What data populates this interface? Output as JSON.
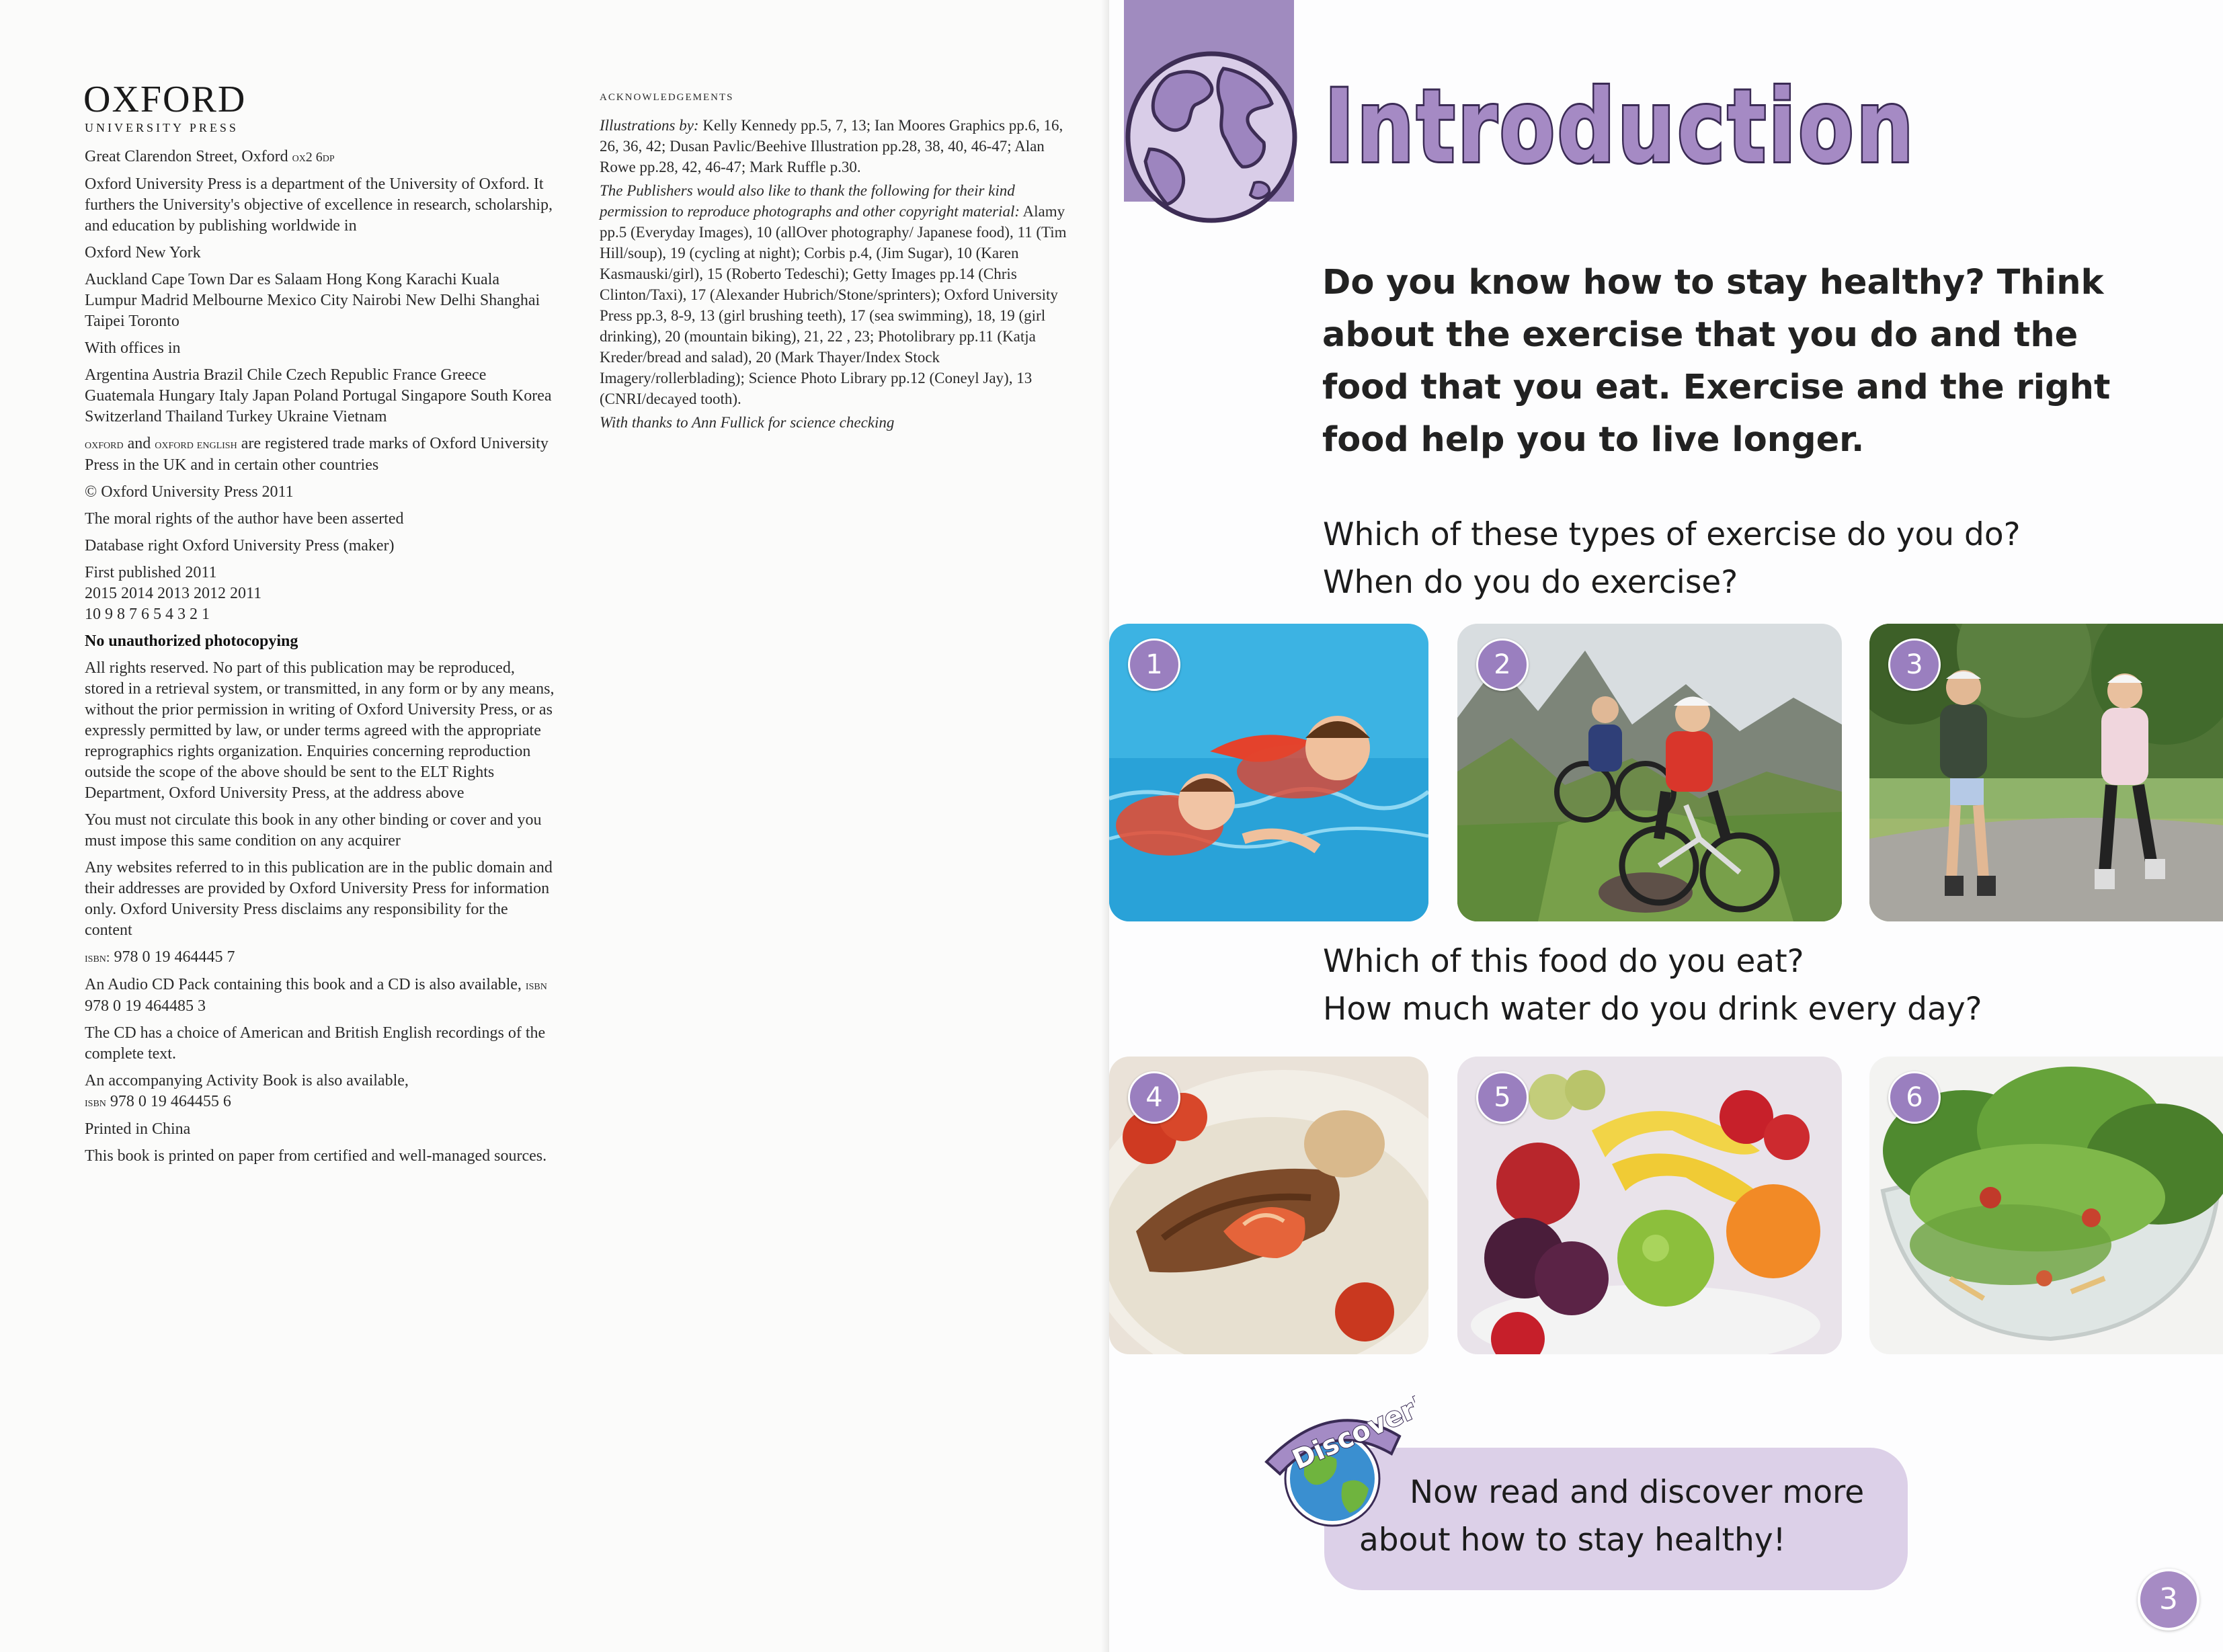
{
  "left_page": {
    "logo": {
      "name": "OXFORD",
      "sub": "UNIVERSITY PRESS"
    },
    "imprint": {
      "address_prefix": "Great Clarendon Street, Oxford",
      "postcode": "ox2 6dp",
      "mission": "Oxford University Press is a department of the University of Oxford. It furthers the University's objective of excellence in research, scholarship, and education by publishing worldwide in",
      "cities_main": "Oxford  New York",
      "cities_list": "Auckland  Cape Town  Dar es Salaam  Hong Kong  Karachi Kuala Lumpur  Madrid  Melbourne  Mexico City  Nairobi New Delhi  Shanghai  Taipei  Toronto",
      "offices_label": "With offices in",
      "countries": "Argentina  Austria  Brazil  Chile  Czech Republic  France Greece  Guatemala  Hungary  Italy  Japan  Poland  Portugal Singapore  South Korea  Switzerland  Thailand  Turkey Ukraine  Vietnam",
      "tm_mark1": "oxford",
      "tm_and": " and ",
      "tm_mark2": "oxford english",
      "tm_rest": " are registered trade marks of Oxford University Press in the UK and in certain other countries",
      "copyright": "© Oxford University Press 2011",
      "moral_rights": "The moral rights of the author have been asserted",
      "database": "Database right Oxford University Press (maker)",
      "first_published": "First published 2011",
      "years": "2015  2014  2013  2012  2011",
      "impression": "10  9  8  7  6  5  4  3  2  1",
      "no_photocopy": "No unauthorized photocopying",
      "rights": "All rights reserved. No part of this publication may be reproduced, stored in a retrieval system, or transmitted, in any form or by any means, without the prior permission in writing of Oxford University Press, or as expressly permitted by law, or under terms agreed with the appropriate reprographics rights organization. Enquiries concerning reproduction outside the scope of the above should be sent to the ELT Rights Department, Oxford University Press, at the address above",
      "circulate": "You must not circulate this book in any other binding or cover and you must impose this same condition on any acquirer",
      "websites": "Any websites referred to in this publication are in the public domain and their addresses are provided by Oxford University Press for information only. Oxford University Press disclaims any responsibility for the content",
      "isbn_label": "isbn:",
      "isbn": " 978 0 19 464445 7",
      "audio_text": "An Audio CD Pack containing this book and a CD is also available, ",
      "audio_isbn_label": "isbn",
      "audio_isbn": " 978 0 19 464485 3",
      "cd_text": "The CD has a choice of American and British English recordings of the complete text.",
      "activity_text": "An accompanying Activity Book is also available, ",
      "activity_isbn_label": "isbn",
      "activity_isbn": " 978 0 19 464455 6",
      "printed": "Printed in China",
      "paper": "This book is printed on paper from certified and well-managed sources."
    },
    "acknowledgements": {
      "heading": "ACKNOWLEDGEMENTS",
      "illus_label": "Illustrations by:",
      "illus_text": " Kelly Kennedy pp.5, 7, 13; Ian Moores Graphics pp.6, 16, 26, 36, 42; Dusan Pavlic/Beehive Illustration pp.28, 38, 40, 46-47; Alan Rowe pp.28, 42, 46-47; Mark Ruffle p.30.",
      "thanks_intro": "The Publishers would also like to thank the following for their kind permission to reproduce photographs and other copyright material:",
      "photo_credits": " Alamy pp.5 (Everyday Images), 10 (allOver photography/ Japanese food), 11 (Tim Hill/soup), 19 (cycling at night); Corbis p.4, (Jim Sugar), 10 (Karen Kasmauski/girl), 15 (Roberto Tedeschi); Getty Images pp.14 (Chris Clinton/Taxi), 17 (Alexander Hubrich/Stone/sprinters); Oxford University Press pp.3, 8-9, 13 (girl brushing teeth), 17 (sea swimming), 18, 19 (girl drinking), 20 (mountain biking), 21, 22 , 23; Photolibrary pp.11 (Katja Kreder/bread and salad), 20 (Mark Thayer/Index Stock Imagery/rollerblading); Science Photo Library pp.12 (Coneyl Jay), 13 (CNRI/decayed tooth).",
      "science_check": "With thanks to Ann Fullick for science checking"
    }
  },
  "right_page": {
    "title": "Introduction",
    "lead": "Do you know how to stay healthy? Think about the exercise that you do and the food that you eat. Exercise and the right food help you to live longer.",
    "exercise_q1": "Which of these types of exercise do you do?",
    "exercise_q2": "When do you do exercise?",
    "food_q1": "Which of this food do you eat?",
    "food_q2": "How much water do you drink every day?",
    "photo_numbers": [
      "1",
      "2",
      "3",
      "4",
      "5",
      "6"
    ],
    "discover_badge": "Discover!",
    "discover_line1": "Now read and discover more",
    "discover_line2": "about how to stay healthy!",
    "page_number": "3"
  },
  "icons": [
    "globe-icon",
    "discover-globe-icon"
  ],
  "colors": {
    "accent_purple": "#a08bbf",
    "callout_lilac": "#dcd0e8"
  }
}
